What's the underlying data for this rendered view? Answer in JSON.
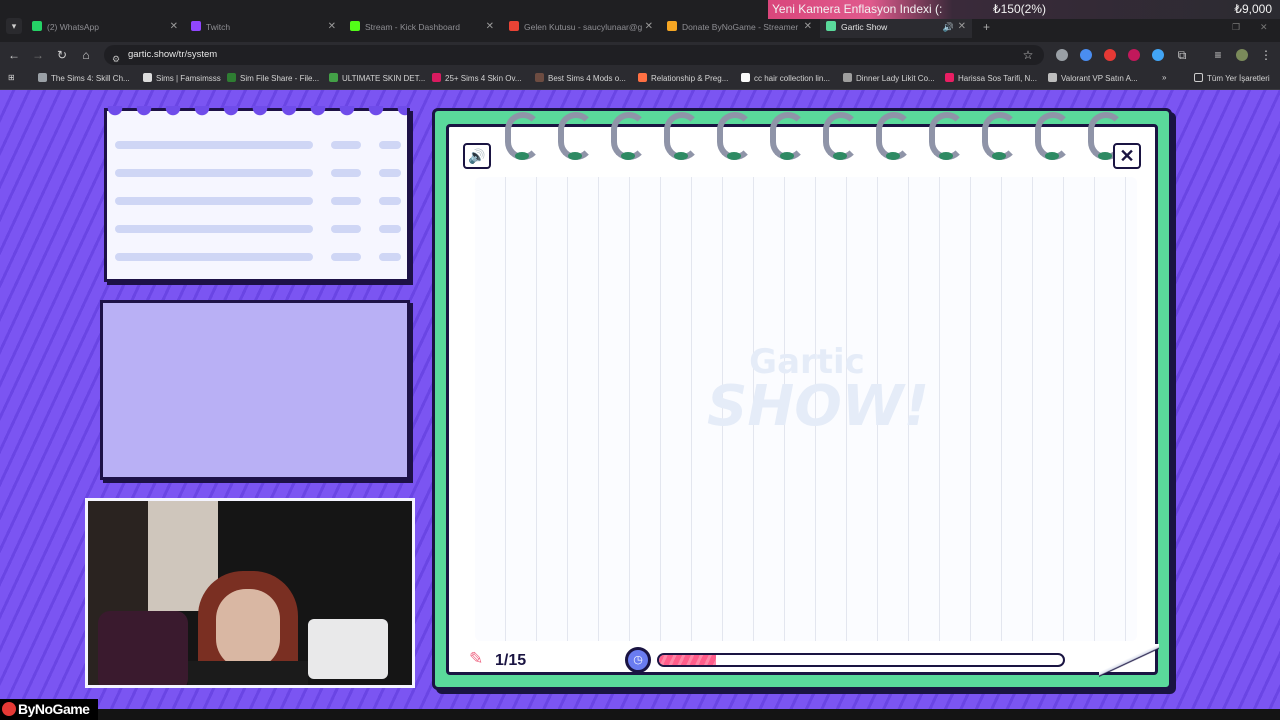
{
  "browser": {
    "tabs": [
      {
        "title": "(2) WhatsApp",
        "color": "#25d366"
      },
      {
        "title": "Twitch",
        "color": "#9146ff"
      },
      {
        "title": "Stream - Kick Dashboard",
        "color": "#53fc18"
      },
      {
        "title": "Gelen Kutusu - saucylunaar@g",
        "color": "#ea4335"
      },
      {
        "title": "Donate ByNoGame - Streamer",
        "color": "#f5a623"
      },
      {
        "title": "Gartic Show",
        "color": "#5ad99b"
      }
    ],
    "url": "gartic.show/tr/system",
    "bookmarks": [
      "The Sims 4: Skill Ch...",
      "Sims | Famsimsss",
      "Sim File Share - File...",
      "ULTIMATE SKIN DET...",
      "25+ Sims 4 Skin Ov...",
      "Best Sims 4 Mods o...",
      "Relationship & Preg...",
      "cc hair collection lin...",
      "Dinner Lady Likit Co...",
      "Harissa Sos Tarifi, N...",
      "Valorant VP Satın A..."
    ],
    "all_bookmarks_label": "Tüm Yer İşaretleri",
    "more_label": "»"
  },
  "ticker": {
    "headline": "Yeni Kamera Enflasyon Indexi (:",
    "change": "₺150(2%)",
    "price": "₺9,000",
    "accent": "#e05a8d"
  },
  "game": {
    "round": "1/15",
    "timer_fraction": 0.14,
    "watermark_top": "Gartic",
    "watermark_bottom": "SHOW!",
    "board_color": "#5ad99b",
    "timer_color": "#ff5c8a"
  },
  "overlay": {
    "brand": "ByNoGame"
  },
  "icons": {
    "sound": "speaker-icon",
    "close": "close-icon",
    "pencil": "pencil-icon",
    "timer": "stopwatch-icon"
  }
}
